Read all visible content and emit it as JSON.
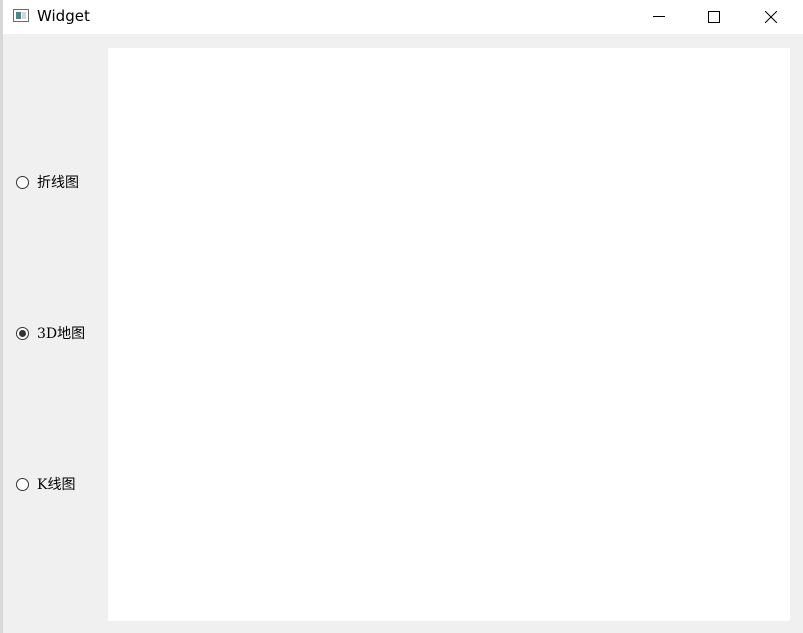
{
  "window": {
    "title": "Widget",
    "app_icon": "widget-window-icon",
    "controls": {
      "minimize_icon": "minimize-icon",
      "maximize_icon": "maximize-icon",
      "close_icon": "close-icon"
    }
  },
  "chart_selector": {
    "options": [
      {
        "label": "折线图",
        "checked": false
      },
      {
        "label": "3D地图",
        "checked": true
      },
      {
        "label": "K线图",
        "checked": false
      }
    ]
  },
  "colors": {
    "window_bg": "#f0f0f0",
    "canvas_bg": "#ffffff",
    "titlebar_bg": "#ffffff"
  }
}
